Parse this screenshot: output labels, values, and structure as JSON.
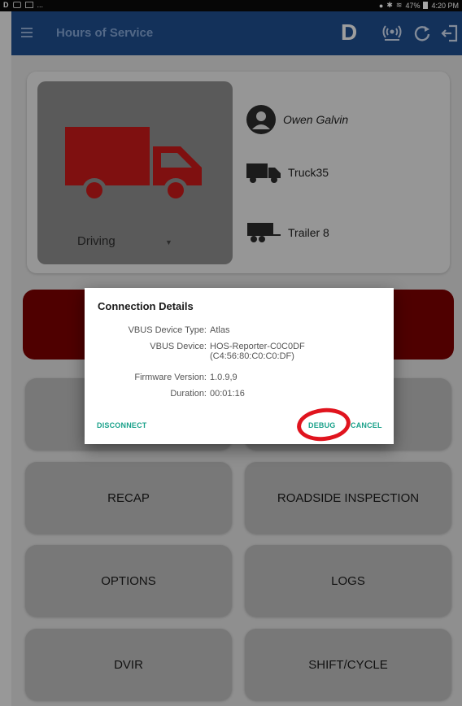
{
  "statusbar": {
    "left_glyph": "D",
    "left_ellipsis": "...",
    "battery": "47%",
    "time": "4:20 PM"
  },
  "appbar": {
    "title": "Hours of Service",
    "status_letter": "D"
  },
  "driver": {
    "duty_status": "Driving",
    "name": "Owen Galvin",
    "truck": "Truck35",
    "trailer": "Trailer 8"
  },
  "colors": {
    "appbar": "#1e4c8a",
    "truck_red": "#c41a1a",
    "accent_teal": "#1aa18a",
    "annotation_red": "#e0141e"
  },
  "grid_buttons": {
    "recap": "RECAP",
    "roadside": "ROADSIDE INSPECTION",
    "options": "OPTIONS",
    "logs": "LOGS",
    "dvir": "DVIR",
    "shift_cycle": "SHIFT/CYCLE"
  },
  "dialog": {
    "title": "Connection Details",
    "rows": [
      {
        "label": "VBUS Device Type:",
        "value": "Atlas"
      },
      {
        "label": "VBUS Device:",
        "value": "HOS-Reporter-C0C0DF",
        "value2": "(C4:56:80:C0:C0:DF)"
      },
      {
        "label": "Firmware Version:",
        "value": "1.0.9,9"
      },
      {
        "label": "Duration:",
        "value": "00:01:16"
      }
    ],
    "disconnect": "DISCONNECT",
    "debug": "DEBUG",
    "cancel": "CANCEL"
  },
  "icons": {
    "menu": "hamburger-icon",
    "device": "broadcast-icon",
    "refresh": "refresh-icon",
    "logout": "logout-icon",
    "user": "user-icon",
    "truck": "truck-icon",
    "trailer": "trailer-icon"
  }
}
